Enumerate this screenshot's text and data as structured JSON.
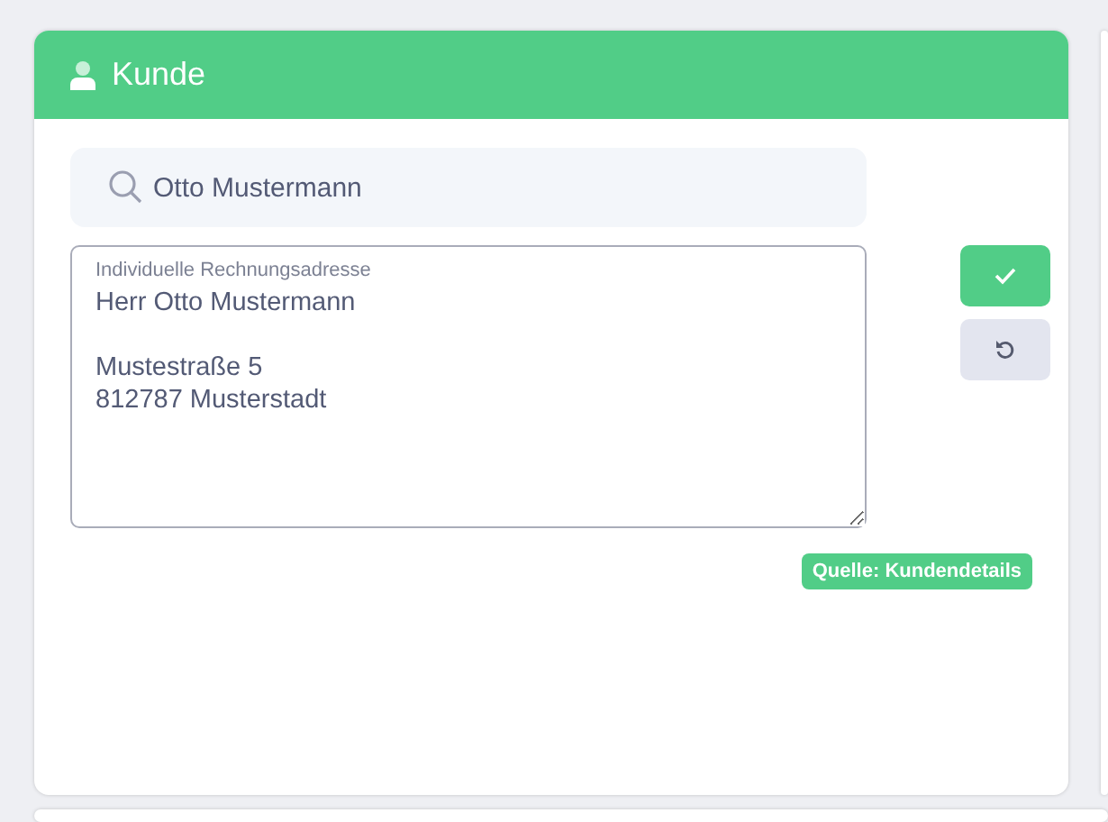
{
  "panel": {
    "title": "Kunde"
  },
  "search": {
    "value": "Otto Mustermann"
  },
  "address": {
    "label": "Individuelle Rechnungsadresse",
    "value": "Herr Otto Mustermann\n\nMustestraße 5\n812787 Musterstadt"
  },
  "actions": [
    {
      "kind": "confirm"
    },
    {
      "kind": "reset"
    }
  ],
  "source_badge": "Quelle: Kundendetails"
}
